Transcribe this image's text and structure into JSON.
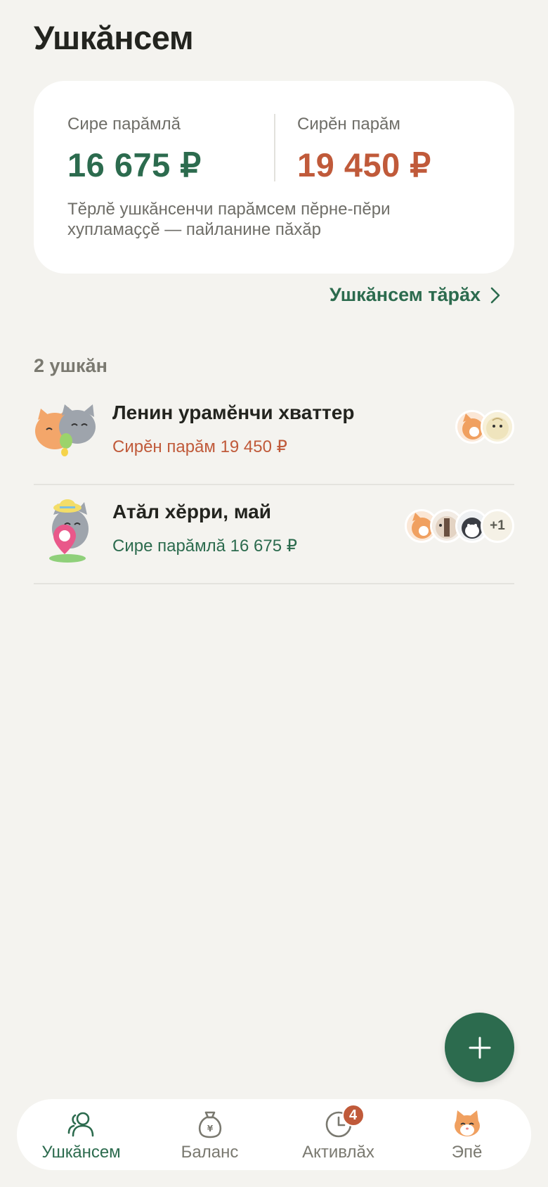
{
  "title": "Ушкӑнсем",
  "summary": {
    "owed_label": "Сире парӑмлӑ",
    "owed_value": "16 675 ₽",
    "debt_label": "Сирӗн парӑм",
    "debt_value": "19 450 ₽",
    "note": "Тӗрлӗ ушкӑнсенчи парӑмсем пӗрне-пӗри хупламаҫҫӗ — пайланине пӑхӑр"
  },
  "compare_link": "Ушкӑнсем тӑрӑх",
  "groups_count": "2 ушкӑн",
  "groups": [
    {
      "name": "Ленин урамӗнчи хваттер",
      "status": "Сирӗн парӑм 19 450 ₽",
      "status_color": "#c05a3a",
      "more_members": ""
    },
    {
      "name": "Атӑл хӗрри, май",
      "status": "Сире парӑмлӑ 16 675 ₽",
      "status_color": "#2c6b4e",
      "more_members": "+1"
    }
  ],
  "nav": {
    "groups": "Ушкӑнсем",
    "balance": "Баланс",
    "activity": "Активлӑх",
    "activity_badge": "4",
    "me": "Эпӗ"
  },
  "colors": {
    "accent": "#2c6b4e",
    "debt": "#c05a3a",
    "background": "#f4f3ef"
  }
}
